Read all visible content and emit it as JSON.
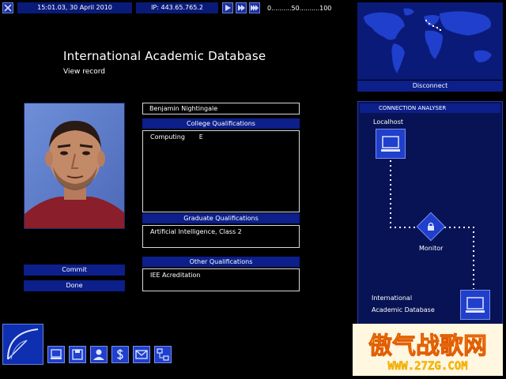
{
  "topbar": {
    "clock": "15:01.03, 30 April 2010",
    "ip": "IP: 443.65.765.2",
    "speed_ruler": "0..........50..........100"
  },
  "record": {
    "title": "International Academic Database",
    "subtitle": "View record",
    "name": "Benjamin Nightingale",
    "college_label": "College Qualifications",
    "college_value": "Computing       E",
    "graduate_label": "Graduate Qualifications",
    "graduate_value": "Artificial Intelligence, Class 2",
    "other_label": "Other Qualifications",
    "other_value": "IEE Acreditation"
  },
  "buttons": {
    "commit": "Commit",
    "done": "Done",
    "disconnect": "Disconnect"
  },
  "analyser": {
    "title": "CONNECTION ANALYSER",
    "localhost": "Localhost",
    "monitor": "Monitor",
    "target_line1": "International",
    "target_line2": "Academic Database"
  },
  "watermark": {
    "line1": "傲气战歌网",
    "line2": "WWW.27ZG.COM"
  },
  "colors": {
    "panel_blue": "#0c1f8a",
    "node_blue": "#1f3fcc",
    "background": "#000000"
  }
}
